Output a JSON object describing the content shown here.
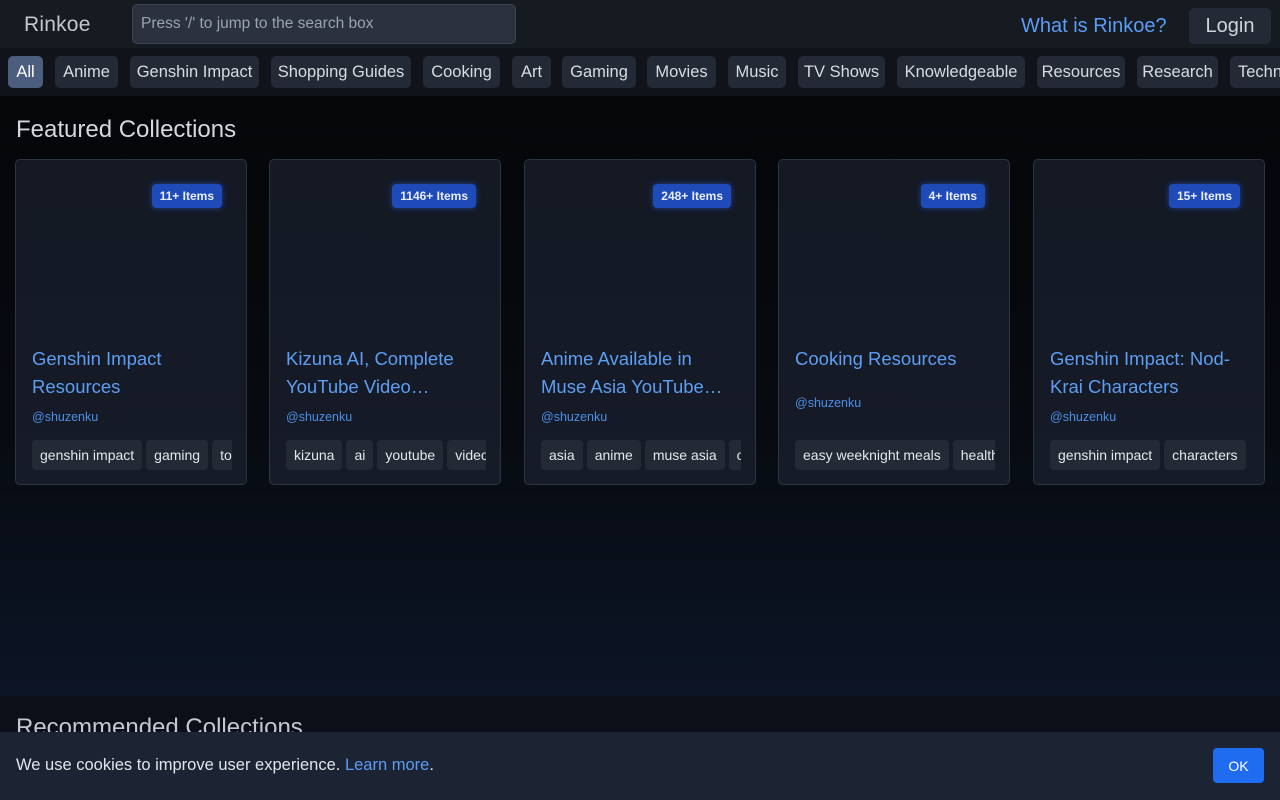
{
  "header": {
    "brand": "Rinkoe",
    "search_placeholder": "Press '/' to jump to the search box",
    "what_link": "What is Rinkoe?",
    "login_label": "Login"
  },
  "categories": [
    {
      "label": "All",
      "active": true
    },
    {
      "label": "Anime"
    },
    {
      "label": "Genshin Impact"
    },
    {
      "label": "Shopping Guides"
    },
    {
      "label": "Cooking"
    },
    {
      "label": "Art"
    },
    {
      "label": "Gaming"
    },
    {
      "label": "Movies"
    },
    {
      "label": "Music"
    },
    {
      "label": "TV Shows"
    },
    {
      "label": "Knowledgeable"
    },
    {
      "label": "Resources"
    },
    {
      "label": "Research"
    },
    {
      "label": "Technology"
    }
  ],
  "featured": {
    "title": "Featured Collections",
    "cards": [
      {
        "badge": "11+ Items",
        "title": "Genshin Impact Resources",
        "author": "@shuzenku",
        "tags": [
          "genshin impact",
          "gaming",
          "tools"
        ]
      },
      {
        "badge": "1146+ Items",
        "title": "Kizuna AI, Complete YouTube Video Directory",
        "author": "@shuzenku",
        "tags": [
          "kizuna",
          "ai",
          "youtube",
          "video"
        ]
      },
      {
        "badge": "248+ Items",
        "title": "Anime Available in Muse Asia YouTube Channel",
        "author": "@shuzenku",
        "tags": [
          "asia",
          "anime",
          "muse asia",
          "official"
        ]
      },
      {
        "badge": "4+ Items",
        "title": "Cooking Resources",
        "author": "@shuzenku",
        "tags": [
          "easy weeknight meals",
          "healthy"
        ]
      },
      {
        "badge": "15+ Items",
        "title": "Genshin Impact: Nod-Krai Characters",
        "author": "@shuzenku",
        "tags": [
          "genshin impact",
          "characters"
        ]
      }
    ]
  },
  "recommended": {
    "title": "Recommended Collections"
  },
  "cookie": {
    "text": "We use cookies to improve user experience.",
    "link": "Learn more",
    "period": ".",
    "ok_label": "OK"
  }
}
